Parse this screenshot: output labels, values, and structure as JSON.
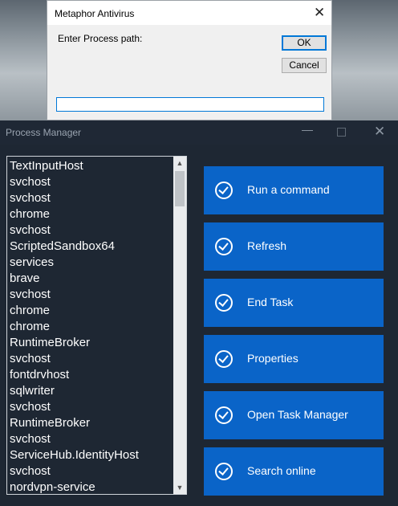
{
  "dialog": {
    "title": "Metaphor Antivirus",
    "close_glyph": "✕",
    "prompt": "Enter Process path:",
    "ok_label": "OK",
    "cancel_label": "Cancel",
    "input_value": ""
  },
  "process_manager": {
    "title": "Process Manager",
    "min_glyph": "—",
    "close_glyph": "✕",
    "processes": [
      "TextInputHost",
      "svchost",
      "svchost",
      "chrome",
      "svchost",
      "ScriptedSandbox64",
      "services",
      "brave",
      "svchost",
      "chrome",
      "chrome",
      "RuntimeBroker",
      "svchost",
      "fontdrvhost",
      "sqlwriter",
      "svchost",
      "RuntimeBroker",
      "svchost",
      "ServiceHub.IdentityHost",
      "svchost",
      "nordvpn-service"
    ],
    "scroll_up_glyph": "▲",
    "scroll_down_glyph": "▼",
    "actions": [
      {
        "label": "Run a command",
        "icon": "check-circle-icon"
      },
      {
        "label": "Refresh",
        "icon": "check-circle-icon"
      },
      {
        "label": "End Task",
        "icon": "check-circle-icon"
      },
      {
        "label": "Properties",
        "icon": "check-circle-icon"
      },
      {
        "label": "Open Task Manager",
        "icon": "check-circle-icon"
      },
      {
        "label": "Search online",
        "icon": "check-circle-icon"
      }
    ]
  },
  "colors": {
    "accent": "#0a64c8",
    "window_bg": "#1e2733",
    "dialog_focus": "#0078d7"
  }
}
